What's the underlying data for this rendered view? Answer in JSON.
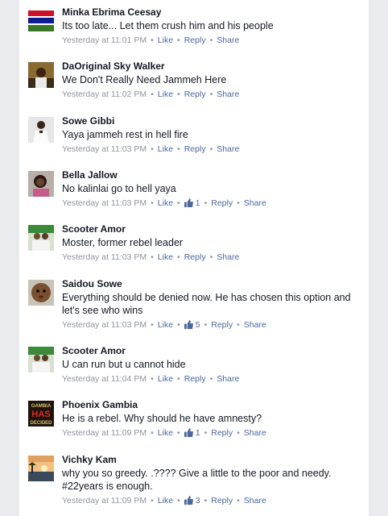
{
  "comments": [
    {
      "author": "Minka Ebrima Ceesay",
      "text": "Its too late... Let them crush him and his people",
      "time": "Yesterday at 11:01 PM",
      "like": "Like",
      "reply": "Reply",
      "share": "Share",
      "likes": null,
      "avatar": "gambia-flag"
    },
    {
      "author": "DaOriginal Sky Walker",
      "text": "We Don't Really Need Jammeh Here",
      "time": "Yesterday at 11:02 PM",
      "like": "Like",
      "reply": "Reply",
      "share": "Share",
      "likes": null,
      "avatar": "man-portrait"
    },
    {
      "author": "Sowe Gibbi",
      "text": "Yaya jammeh rest in hell fire",
      "time": "Yesterday at 11:03 PM",
      "like": "Like",
      "reply": "Reply",
      "share": "Share",
      "likes": null,
      "avatar": "man-white-shirt"
    },
    {
      "author": "Bella Jallow",
      "text": "No kalinlai go to hell yaya",
      "time": "Yesterday at 11:03 PM",
      "like": "Like",
      "reply": "Reply",
      "share": "Share",
      "likes": "1",
      "avatar": "woman-portrait"
    },
    {
      "author": "Scooter Amor",
      "text": "Moster, former rebel leader",
      "time": "Yesterday at 11:03 PM",
      "like": "Like",
      "reply": "Reply",
      "share": "Share",
      "likes": null,
      "avatar": "group-photo"
    },
    {
      "author": "Saidou Sowe",
      "text": "Everything should be denied now. He has chosen this option and let's see who wins",
      "time": "Yesterday at 11:03 PM",
      "like": "Like",
      "reply": "Reply",
      "share": "Share",
      "likes": "5",
      "avatar": "child-portrait"
    },
    {
      "author": "Scooter Amor",
      "text": "U can run but u cannot hide",
      "time": "Yesterday at 11:04 PM",
      "like": "Like",
      "reply": "Reply",
      "share": "Share",
      "likes": null,
      "avatar": "group-photo"
    },
    {
      "author": "Phoenix Gambia",
      "text": "He is a rebel.  Why should he have amnesty?",
      "time": "Yesterday at 11:09 PM",
      "like": "Like",
      "reply": "Reply",
      "share": "Share",
      "likes": "1",
      "avatar": "gambia-has-decided-poster",
      "avatar_lettering": [
        "GAMBIA",
        "HAS",
        "DECIDED"
      ]
    },
    {
      "author": "Vichky Kam",
      "text_parts": [
        "why you so greedy. .???? Give a little to the poor and needy. ",
        "#22years",
        " is enough."
      ],
      "time": "Yesterday at 11:09 PM",
      "like": "Like",
      "reply": "Reply",
      "share": "Share",
      "likes": "3",
      "avatar": "sunset-landscape"
    }
  ],
  "colors": {
    "link": "#4b67a1",
    "meta": "#90949c",
    "name": "#141823",
    "background": "#e9ebee"
  }
}
